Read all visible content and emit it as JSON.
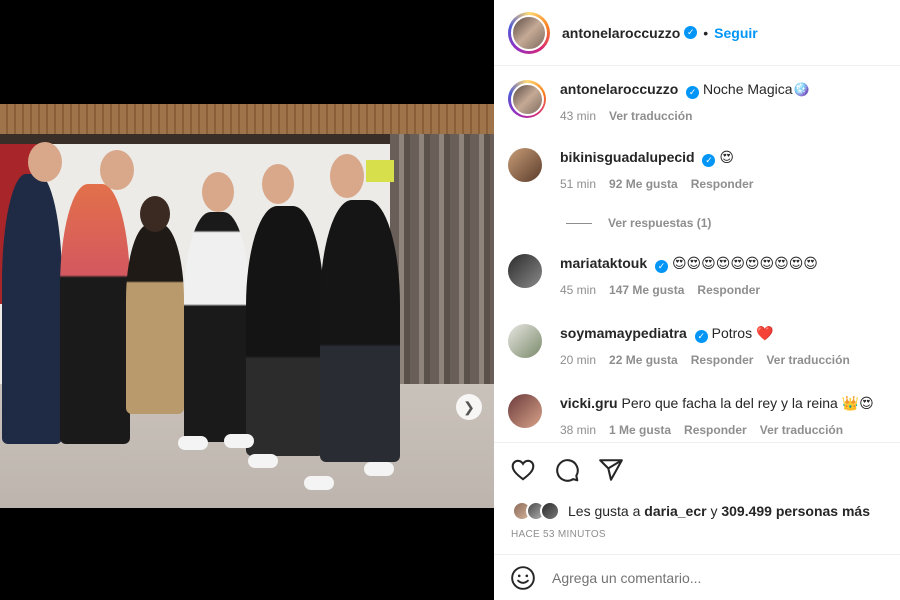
{
  "post": {
    "username": "antonelaroccuzzo",
    "follow_label": "Seguir",
    "separator": "•",
    "caption_text": "Noche Magica",
    "caption_emoji": "🪩",
    "caption_time": "43 min",
    "caption_translate": "Ver traducción"
  },
  "comments": [
    {
      "user": "bikinisguadalupecid",
      "text": "",
      "emoji": "😍",
      "time": "51 min",
      "likes": "92 Me gusta",
      "reply": "Responder",
      "translate": "",
      "verified": true
    },
    {
      "user": "mariataktouk",
      "text": "",
      "emoji": "😍😍😍😍😍😍😍😍😍😍",
      "time": "45 min",
      "likes": "147 Me gusta",
      "reply": "Responder",
      "translate": "",
      "verified": true
    },
    {
      "user": "soymamaypediatra",
      "text": "Potros",
      "emoji": "❤️",
      "time": "20 min",
      "likes": "22 Me gusta",
      "reply": "Responder",
      "translate": "Ver traducción",
      "verified": true
    },
    {
      "user": "vicki.gru",
      "text": "Pero que facha la del rey y la reina",
      "emoji": "👑😍",
      "time": "38 min",
      "likes": "1 Me gusta",
      "reply": "Responder",
      "translate": "Ver traducción",
      "verified": false
    }
  ],
  "view_replies": "Ver respuestas (1)",
  "likes": {
    "prefix": "Les gusta a",
    "user": "daria_ecr",
    "conjunction": "y",
    "count": "309.499 personas más"
  },
  "time_ago": "HACE 53 MINUTOS",
  "add_comment": {
    "placeholder": "Agrega un comentario..."
  },
  "colors": {
    "accent": "#0095f6",
    "like_red": "#ed4956"
  },
  "icons": [
    "heart-icon",
    "comment-icon",
    "share-icon",
    "emoji-smile-icon",
    "verified-icon",
    "chevron-right-icon"
  ],
  "carousel": {
    "current_slide": 1,
    "total_slides": 2
  }
}
